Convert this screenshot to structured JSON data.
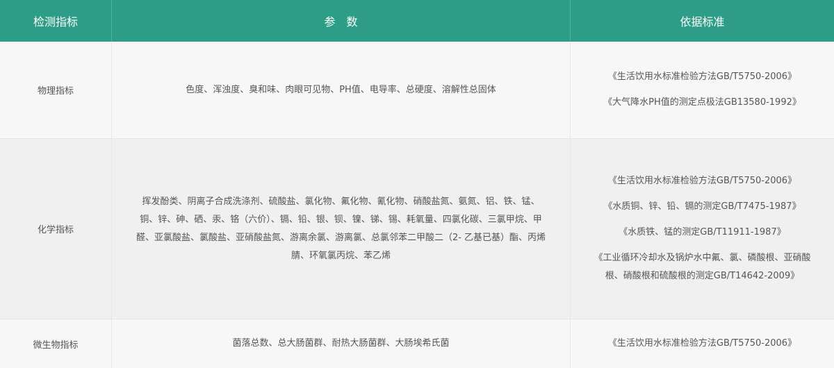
{
  "headers": {
    "indicator": "检测指标",
    "params": "参　数",
    "standard": "依据标准"
  },
  "rows": [
    {
      "indicator": "物理指标",
      "params": "色度、浑浊度、臭和味、肉眼可见物、PH值、电导率、总硬度、溶解性总固体",
      "standards": [
        "《生活饮用水标准检验方法GB/T5750-2006》",
        "《大气降水PH值的测定点极法GB13580-1992》"
      ]
    },
    {
      "indicator": "化学指标",
      "params": "挥发酚类、阴离子合成洗涤剂、硫酸盐、氯化物、氟化物、氰化物、硝酸盐氮、氨氮、铝、铁、锰、铜、锌、砷、硒、汞、铬（六价）、镉、铅、银、钡、镍、锑、锡、耗氧量、四氯化碳、三氯甲烷、甲醛、亚氯酸盐、氯酸盐、亚硝酸盐氮、游离余氯、游离氯、总氯邻苯二甲酸二（2- 乙基已基）酯、丙烯腈、环氧氯丙烷、苯乙烯",
      "standards": [
        "《生活饮用水标准检验方法GB/T5750-2006》",
        "《水质铜、锌、铅、镉的测定GB/T7475-1987》",
        "《水质铁、锰的测定GB/T11911-1987》",
        "《工业循环冷却水及锅炉水中氟、氯、磷酸根、亚硝酸根、硝酸根和硫酸根的测定GB/T14642-2009》"
      ]
    },
    {
      "indicator": "微生物指标",
      "params": "菌落总数、总大肠菌群、耐热大肠菌群、大肠埃希氏菌",
      "standards": [
        "《生活饮用水标准检验方法GB/T5750-2006》"
      ]
    }
  ]
}
